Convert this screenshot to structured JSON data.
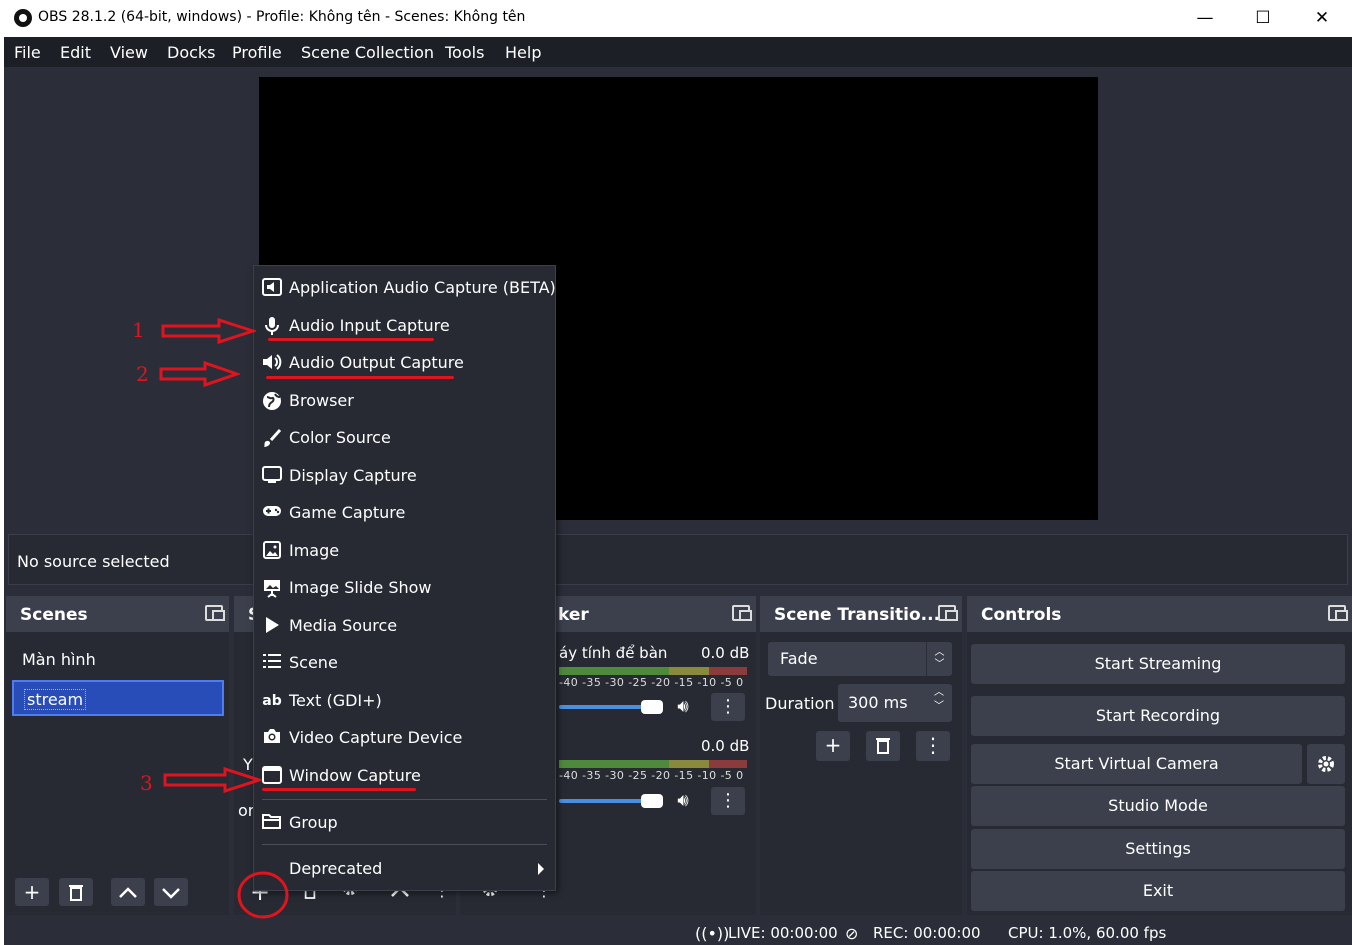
{
  "window": {
    "title": "OBS 28.1.2 (64-bit, windows) - Profile: Không tên - Scenes: Không tên",
    "minimize": "—",
    "maximize": "☐",
    "close": "✕"
  },
  "menu": [
    "File",
    "Edit",
    "View",
    "Docks",
    "Profile",
    "Scene Collection",
    "Tools",
    "Help"
  ],
  "context_bar": {
    "text": "No source selected"
  },
  "scenes": {
    "title": "Scenes",
    "items": [
      "Màn hình",
      "stream"
    ],
    "selected": "stream"
  },
  "sources_partial": {
    "title_fragment": "S",
    "text1": "Y",
    "text2": "or"
  },
  "audio_mixer": {
    "title_fragment": "ker",
    "channels": [
      {
        "name": "áy tính để bàn",
        "db": "0.0 dB"
      },
      {
        "name": "",
        "db": "0.0 dB"
      }
    ],
    "ticks": "-40 -35 -30 -25 -20 -15 -10 -5 0"
  },
  "transitions": {
    "title": "Scene Transitio...",
    "selected": "Fade",
    "duration_label": "Duration",
    "duration_value": "300 ms"
  },
  "controls": {
    "title": "Controls",
    "buttons": [
      "Start Streaming",
      "Start Recording",
      "Start Virtual Camera",
      "Studio Mode",
      "Settings",
      "Exit"
    ]
  },
  "add_source_menu": {
    "items": [
      {
        "label": "Application Audio Capture (BETA)",
        "icon": "app-audio-icon"
      },
      {
        "label": "Audio Input Capture",
        "icon": "microphone-icon"
      },
      {
        "label": "Audio Output Capture",
        "icon": "speaker-icon"
      },
      {
        "label": "Browser",
        "icon": "globe-icon"
      },
      {
        "label": "Color Source",
        "icon": "brush-icon"
      },
      {
        "label": "Display Capture",
        "icon": "monitor-icon"
      },
      {
        "label": "Game Capture",
        "icon": "gamepad-icon"
      },
      {
        "label": "Image",
        "icon": "image-icon"
      },
      {
        "label": "Image Slide Show",
        "icon": "slideshow-icon"
      },
      {
        "label": "Media Source",
        "icon": "play-icon"
      },
      {
        "label": "Scene",
        "icon": "list-icon"
      },
      {
        "label": "Text (GDI+)",
        "icon": "text-icon"
      },
      {
        "label": "Video Capture Device",
        "icon": "camera-icon"
      },
      {
        "label": "Window Capture",
        "icon": "window-icon"
      },
      {
        "label": "Group",
        "icon": "folder-icon"
      },
      {
        "label": "Deprecated",
        "icon": ""
      }
    ]
  },
  "annotations": [
    "1",
    "2",
    "3"
  ],
  "status": {
    "live": "LIVE: 00:00:00",
    "rec": "REC: 00:00:00",
    "cpu": "CPU: 1.0%, 60.00 fps"
  },
  "colors": {
    "accent": "#284cb8",
    "annotation": "#e0141e",
    "panel": "#272a33",
    "header": "#3c404d"
  }
}
